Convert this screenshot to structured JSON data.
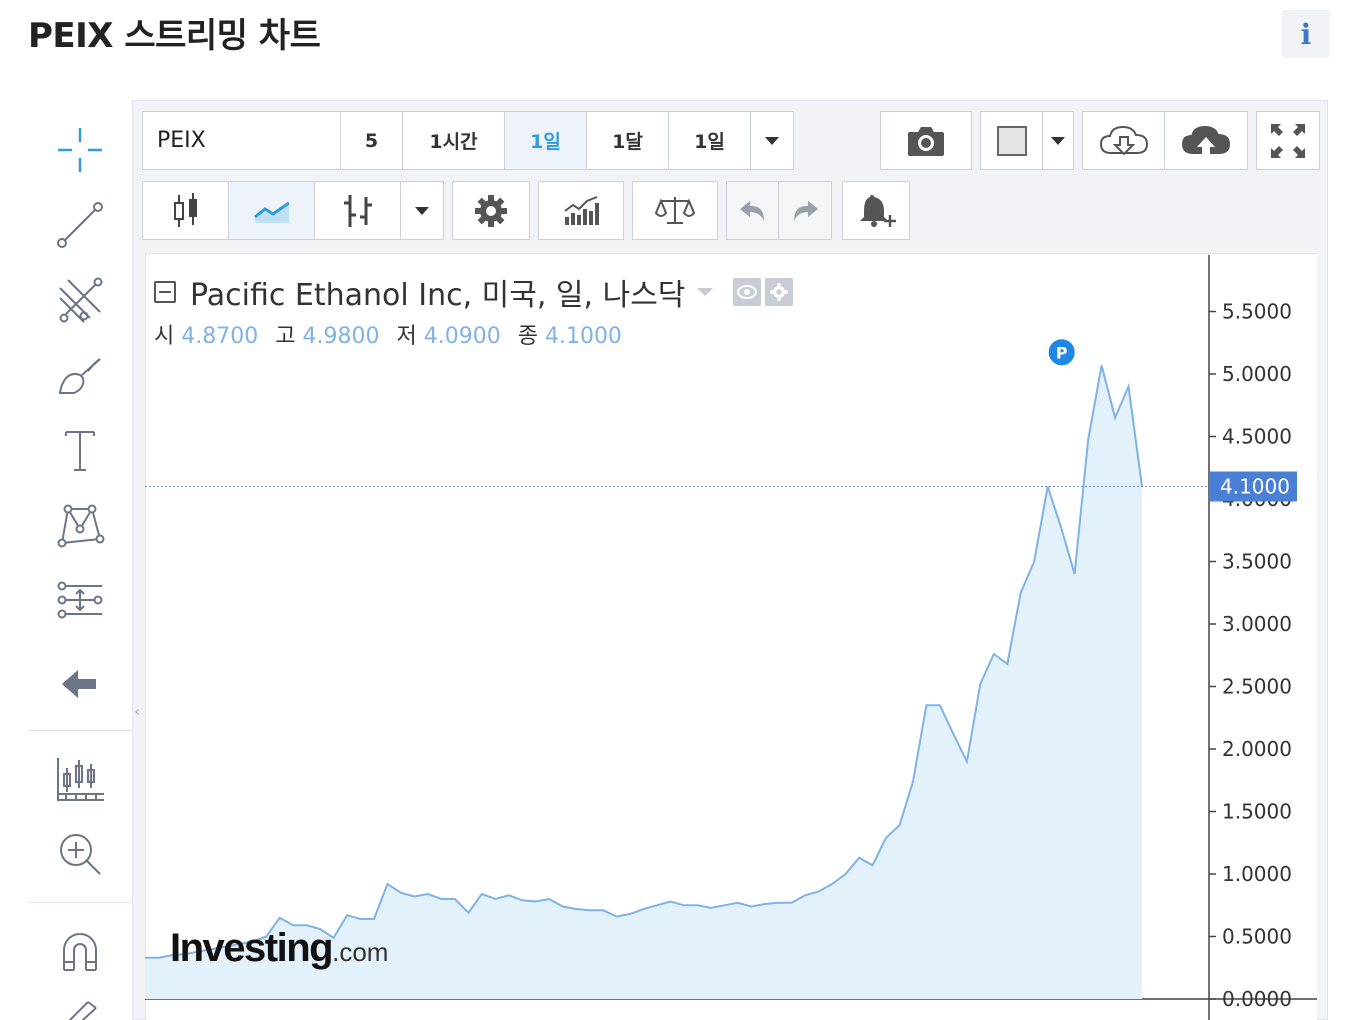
{
  "page": {
    "title": "PEIX 스트리밍 차트",
    "info_label": "i"
  },
  "toolbar": {
    "symbol": "PEIX",
    "intervals": [
      "5",
      "1시간",
      "1일",
      "1달",
      "1일"
    ],
    "active_interval_index": 2
  },
  "legend": {
    "title": "Pacific Ethanol Inc, 미국, 일, 나스닥",
    "open_label": "시",
    "open": "4.8700",
    "high_label": "고",
    "high": "4.9800",
    "low_label": "저",
    "low": "4.0900",
    "close_label": "종",
    "close": "4.1000"
  },
  "price_tag": "4.1000",
  "marker_label": "P",
  "logo": {
    "main": "Investing",
    "suffix": ".com"
  },
  "colors": {
    "line": "#7fb2e5",
    "area_fill": "#e3f1fb",
    "accent": "#2f9cde",
    "price_tag_bg": "#4a7fd6",
    "marker": "#1e88e5"
  },
  "chart_data": {
    "type": "area",
    "y_ticks": [
      "0.0000",
      "0.5000",
      "1.0000",
      "1.5000",
      "2.0000",
      "2.5000",
      "3.0000",
      "3.5000",
      "4.0000",
      "4.5000",
      "5.0000",
      "5.5000"
    ],
    "ylim": [
      0,
      5.75
    ],
    "last_value": 4.1,
    "values": [
      0.33,
      0.33,
      0.35,
      0.36,
      0.38,
      0.4,
      0.42,
      0.44,
      0.46,
      0.5,
      0.65,
      0.59,
      0.59,
      0.56,
      0.49,
      0.67,
      0.64,
      0.64,
      0.92,
      0.85,
      0.82,
      0.84,
      0.8,
      0.8,
      0.69,
      0.84,
      0.8,
      0.83,
      0.79,
      0.78,
      0.8,
      0.74,
      0.72,
      0.71,
      0.71,
      0.66,
      0.68,
      0.72,
      0.75,
      0.78,
      0.75,
      0.75,
      0.73,
      0.75,
      0.77,
      0.74,
      0.76,
      0.77,
      0.77,
      0.83,
      0.86,
      0.92,
      1.0,
      1.13,
      1.07,
      1.29,
      1.39,
      1.74,
      2.35,
      2.35,
      2.12,
      1.9,
      2.52,
      2.76,
      2.68,
      3.25,
      3.5,
      4.1,
      3.77,
      3.4,
      4.47,
      5.07,
      4.65,
      4.9,
      4.1
    ],
    "marker": {
      "label": "P",
      "index": 69
    }
  }
}
